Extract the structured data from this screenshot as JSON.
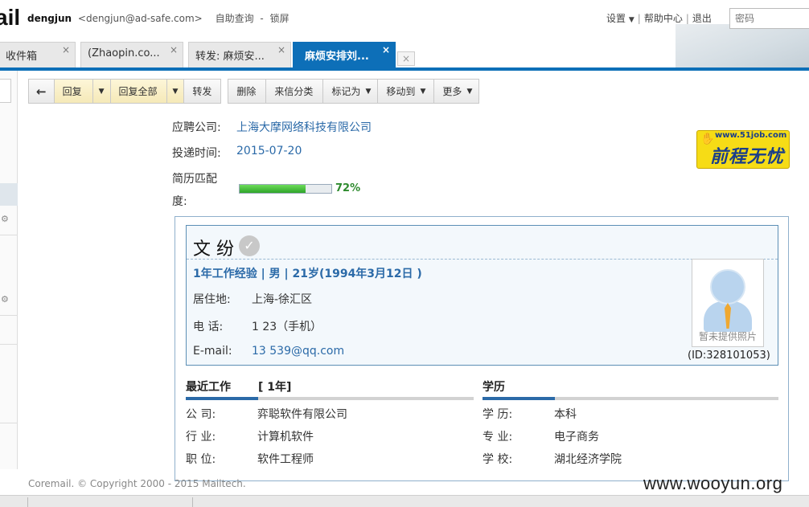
{
  "header": {
    "logo_text": "ail",
    "username": "dengjun",
    "email": "<dengjun@ad-safe.com>",
    "links": [
      "自助查询",
      "-",
      "锁屏"
    ],
    "settings_label": "设置",
    "help_label": "帮助中心",
    "logout_label": "退出",
    "password_placeholder": "密码"
  },
  "tabs": [
    {
      "label": "收件箱",
      "active": false
    },
    {
      "label": "(Zhaopin.co...",
      "active": false
    },
    {
      "label": "转发: 麻烦安...",
      "active": false
    },
    {
      "label": "麻烦安排刘...",
      "active": true
    }
  ],
  "toolbar": {
    "back_icon": "←",
    "reply": "回复",
    "reply_all": "回复全部",
    "forward": "转发",
    "delete": "删除",
    "classify": "来信分类",
    "mark_as": "标记为",
    "move_to": "移动到",
    "more": "更多"
  },
  "application": {
    "company_label": "应聘公司:",
    "company_value": "上海大摩网络科技有限公司",
    "date_label": "投递时间:",
    "date_value": "2015-07-20",
    "match_label_line1": "简历匹配",
    "match_label_line2": "度:",
    "match_percent": "72%",
    "match_fraction": 0.72
  },
  "brand": {
    "url": "www.51job.com",
    "name": "前程无忧"
  },
  "candidate": {
    "name": "文  纷",
    "summary": "1年工作经验 | 男 | 21岁(1994年3月12日 )",
    "residence_label": "居住地:",
    "residence_value": "上海-徐汇区",
    "phone_label": "电   话:",
    "phone_value": "1            23（手机）",
    "email_label": "E-mail:",
    "email_value": "13          539@qq.com",
    "photo_caption": "暂未提供照片",
    "id_text": "(ID:328101053)"
  },
  "recent_work": {
    "title": "最近工作",
    "years": "[ 1年]",
    "rows": [
      {
        "label": "公    司:",
        "value": "弈聪软件有限公司"
      },
      {
        "label": "行    业:",
        "value": "计算机软件"
      },
      {
        "label": "职    位:",
        "value": "软件工程师"
      }
    ]
  },
  "education": {
    "title": "学历",
    "rows": [
      {
        "label": "学    历:",
        "value": "本科"
      },
      {
        "label": "专    业:",
        "value": "电子商务"
      },
      {
        "label": "学    校:",
        "value": "湖北经济学院"
      }
    ]
  },
  "footer": {
    "copyright": "Coremail. © Copyright 2000 - 2015 Mailtech.",
    "watermark": "www.wooyun.org"
  },
  "colors": {
    "accent": "#0d6fb8",
    "link": "#2b6aa8",
    "progress": "#2ea52a"
  }
}
